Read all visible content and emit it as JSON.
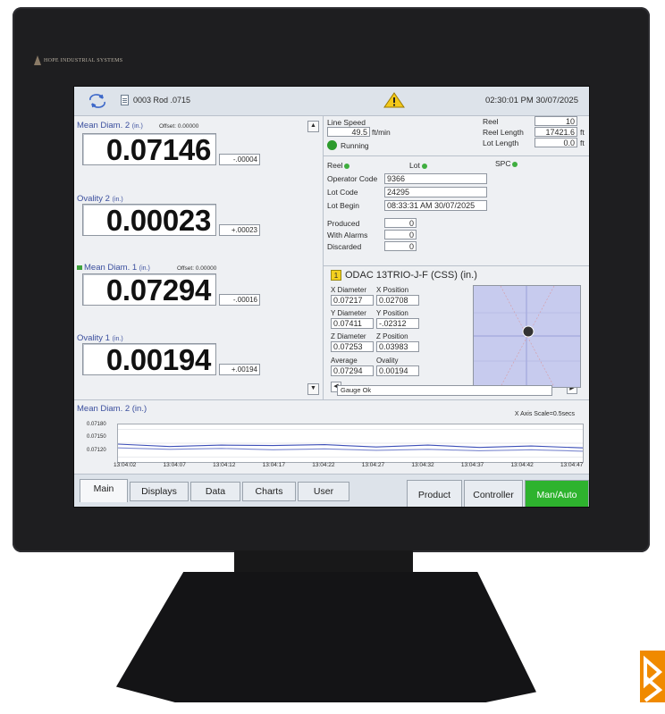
{
  "brand": "HOPE INDUSTRIAL SYSTEMS",
  "header": {
    "job": "0003  Rod .0715",
    "clock": "02:30:01 PM  30/07/2025"
  },
  "left": {
    "m2": {
      "label": "Mean Diam. 2",
      "unit": "(in.)",
      "offset": "Offset: 0.00000",
      "value": "0.07146",
      "dev": "-.00004"
    },
    "o2": {
      "label": "Ovality 2",
      "unit": "(in.)",
      "value": "0.00023",
      "dev": "+.00023"
    },
    "m1": {
      "label": "Mean Diam. 1",
      "unit": "(in.)",
      "offset": "Offset: 0.00000",
      "value": "0.07294",
      "dev": "-.00016"
    },
    "o1": {
      "label": "Ovality 1",
      "unit": "(in.)",
      "value": "0.00194",
      "dev": "+.00194"
    }
  },
  "status": {
    "line_speed_label": "Line Speed",
    "line_speed": "49.5",
    "line_speed_unit": "ft/min",
    "running": "Running",
    "reel_label": "Reel",
    "reel": "10",
    "reel_length_label": "Reel Length",
    "reel_length": "17421.6",
    "lot_length_label": "Lot Length",
    "lot_length": "0.0",
    "ft": "ft"
  },
  "lot": {
    "reel_led": "Reel",
    "lot_led": "Lot",
    "spc_led": "SPC",
    "operator_code_label": "Operator Code",
    "operator_code": "9366",
    "lot_code_label": "Lot Code",
    "lot_code": "24295",
    "lot_begin_label": "Lot Begin",
    "lot_begin": "08:33:31 AM  30/07/2025",
    "produced_label": "Produced",
    "produced": "0",
    "with_alarms_label": "With Alarms",
    "with_alarms": "0",
    "discarded_label": "Discarded",
    "discarded": "0"
  },
  "gauge": {
    "number": "1",
    "title": "ODAC 13TRIO-J-F (CSS) (in.)",
    "x_diam_label": "X Diameter",
    "x_pos_label": "X Position",
    "x_diam": "0.07217",
    "x_pos": "0.02708",
    "y_diam_label": "Y Diameter",
    "y_pos_label": "Y Position",
    "y_diam": "0.07411",
    "y_pos": "-.02312",
    "z_diam_label": "Z Diameter",
    "z_pos_label": "Z Position",
    "z_diam": "0.07253",
    "z_pos": "0.03983",
    "avg_label": "Average",
    "ov_label": "Ovality",
    "avg": "0.07294",
    "ov": "0.00194",
    "status": "Gauge Ok"
  },
  "trend": {
    "title": "Mean Diam. 2  (in.)",
    "scale": "X Axis Scale=0.5secs",
    "y_ticks": [
      "0.07180",
      "0.07150",
      "0.07120"
    ],
    "x_ticks": [
      "13:04:02",
      "13:04:07",
      "13:04:12",
      "13:04:17",
      "13:04:22",
      "13:04:27",
      "13:04:32",
      "13:04:37",
      "13:04:42",
      "13:04:47"
    ]
  },
  "chart_data": {
    "type": "line",
    "title": "Mean Diam. 2  (in.)",
    "xlabel": "",
    "ylabel": "",
    "ylim": [
      0.0711,
      0.0719
    ],
    "x": [
      "13:04:02",
      "13:04:07",
      "13:04:12",
      "13:04:17",
      "13:04:22",
      "13:04:27",
      "13:04:32",
      "13:04:37",
      "13:04:42",
      "13:04:47"
    ],
    "series": [
      {
        "values": [
          0.07148,
          0.07143,
          0.07146,
          0.07145,
          0.07147,
          0.07142,
          0.07146,
          0.07141,
          0.07144,
          0.0714
        ]
      },
      {
        "values": [
          0.0714,
          0.07137,
          0.07139,
          0.07136,
          0.07138,
          0.07135,
          0.07137,
          0.07134,
          0.07136,
          0.07133
        ]
      }
    ]
  },
  "tabs": {
    "main": "Main",
    "displays": "Displays",
    "data": "Data",
    "charts": "Charts",
    "user": "User",
    "product": "Product",
    "controller": "Controller",
    "manauto": "Man/Auto"
  },
  "colors": {
    "accent_blue": "#3b4f9e",
    "status_green": "#2eb32e",
    "warning_yellow": "#f3d01f",
    "series_1": "#3d4fb8",
    "series_2": "#7e8ad0"
  }
}
